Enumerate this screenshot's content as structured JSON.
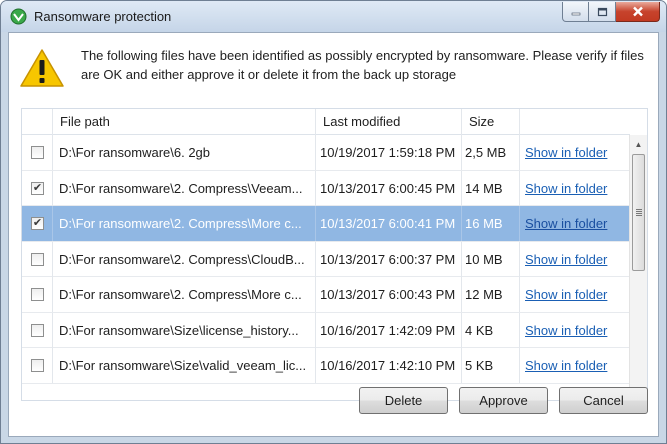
{
  "window": {
    "title": "Ransomware protection",
    "icon": "veeam-app-icon"
  },
  "message": "The following files have been identified as possibly encrypted by ransomware. Please verify if files are OK and either approve it or delete it from the back up storage",
  "table": {
    "columns": [
      "File path",
      "Last modified",
      "Size",
      ""
    ],
    "rows": [
      {
        "checked": false,
        "selected": false,
        "path": "D:\\For ransomware\\6. 2gb",
        "modified": "10/19/2017 1:59:18 PM",
        "size": "2,5 MB",
        "action": "Show in folder"
      },
      {
        "checked": true,
        "selected": false,
        "path": "D:\\For ransomware\\2. Compress\\Veeam...",
        "modified": "10/13/2017 6:00:45 PM",
        "size": "14 MB",
        "action": "Show in folder"
      },
      {
        "checked": true,
        "selected": true,
        "path": "D:\\For ransomware\\2. Compress\\More c...",
        "modified": "10/13/2017 6:00:41 PM",
        "size": "16 MB",
        "action": "Show in folder"
      },
      {
        "checked": false,
        "selected": false,
        "path": "D:\\For ransomware\\2. Compress\\CloudB...",
        "modified": "10/13/2017 6:00:37 PM",
        "size": "10 MB",
        "action": "Show in folder"
      },
      {
        "checked": false,
        "selected": false,
        "path": "D:\\For ransomware\\2. Compress\\More c...",
        "modified": "10/13/2017 6:00:43 PM",
        "size": "12 MB",
        "action": "Show in folder"
      },
      {
        "checked": false,
        "selected": false,
        "path": "D:\\For ransomware\\Size\\license_history...",
        "modified": "10/16/2017 1:42:09 PM",
        "size": "4 KB",
        "action": "Show in folder"
      },
      {
        "checked": false,
        "selected": false,
        "path": "D:\\For ransomware\\Size\\valid_veeam_lic...",
        "modified": "10/16/2017 1:42:10 PM",
        "size": "5 KB",
        "action": "Show in folder"
      }
    ]
  },
  "buttons": {
    "delete": "Delete",
    "approve": "Approve",
    "cancel": "Cancel"
  },
  "colors": {
    "selection": "#90b7e3",
    "link": "#1a5fb4",
    "warning": "#f7c600"
  }
}
